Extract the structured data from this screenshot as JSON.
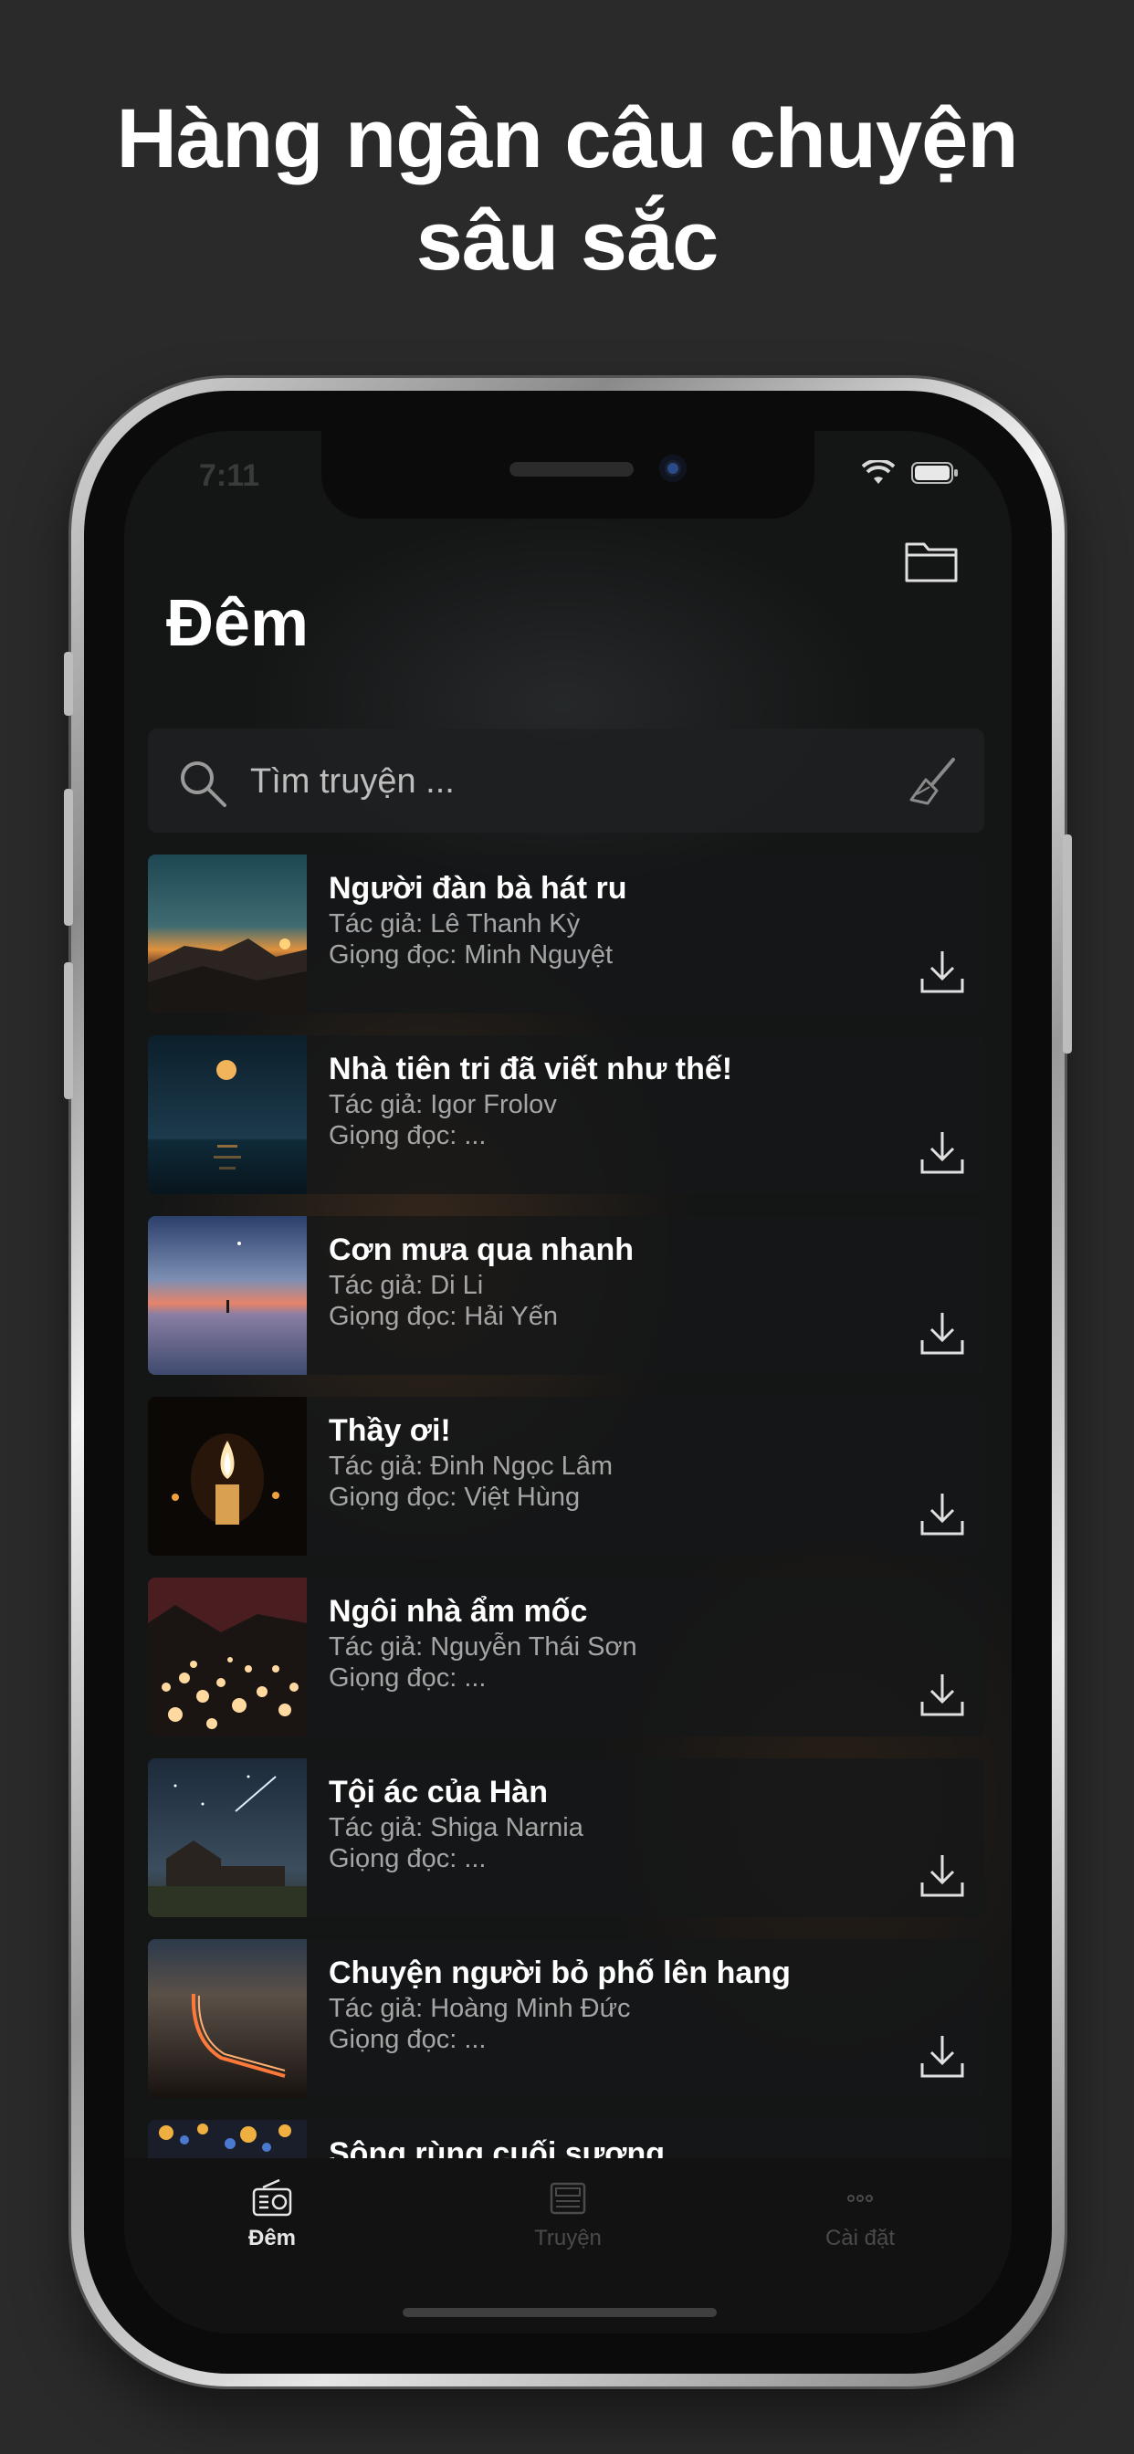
{
  "headline": {
    "line1": "Hàng ngàn câu chuyện",
    "line2": "sâu sắc"
  },
  "status_bar": {
    "time": "7:11"
  },
  "header": {
    "title": "Đêm"
  },
  "search": {
    "placeholder": "Tìm truyện ..."
  },
  "icons": {
    "folder": "folder-icon",
    "search": "search-icon",
    "broom": "broom-icon",
    "download": "download-icon",
    "radio": "radio-icon",
    "newspaper": "newspaper-icon",
    "more": "ellipsis-icon"
  },
  "stories": [
    {
      "title": "Người đàn bà hát ru",
      "author": "Tác giả: Lê Thanh Kỳ",
      "voice": "Giọng đọc: Minh Nguyệt",
      "thumb": "mountain-sunset"
    },
    {
      "title": "Nhà tiên tri đã viết như thế!",
      "author": "Tác giả: Igor Frolov",
      "voice": "Giọng đọc: ...",
      "thumb": "moon-over-sea"
    },
    {
      "title": "Cơn mưa qua nhanh",
      "author": "Tác giả: Di Li",
      "voice": "Giọng đọc: Hải Yến",
      "thumb": "dusk-beach"
    },
    {
      "title": "Thầy ơi!",
      "author": "Tác giả: Đinh Ngọc Lâm",
      "voice": "Giọng đọc: Việt Hùng",
      "thumb": "candles"
    },
    {
      "title": "Ngôi nhà ẩm mốc",
      "author": "Tác giả: Nguyễn Thái Sơn",
      "voice": "Giọng đọc: ...",
      "thumb": "lanterns"
    },
    {
      "title": "Tội ác của Hàn",
      "author": "Tác giả: Shiga Narnia",
      "voice": "Giọng đọc: ...",
      "thumb": "house-meteor"
    },
    {
      "title": "Chuyện người bỏ phố lên hang",
      "author": "Tác giả: Hoàng Minh Đức",
      "voice": "Giọng đọc: ...",
      "thumb": "night-bridge"
    },
    {
      "title": "Sông rùng cuối sương",
      "author": "",
      "voice": "",
      "thumb": "bokeh-lights"
    }
  ],
  "tabs": [
    {
      "label": "Đêm",
      "active": true
    },
    {
      "label": "Truyện",
      "active": false
    },
    {
      "label": "Cài đặt",
      "active": false
    }
  ],
  "colors": {
    "background": "#2a2a2a",
    "screen": "#141515",
    "text_primary": "#ffffff",
    "text_secondary": "#a5a5a5"
  }
}
